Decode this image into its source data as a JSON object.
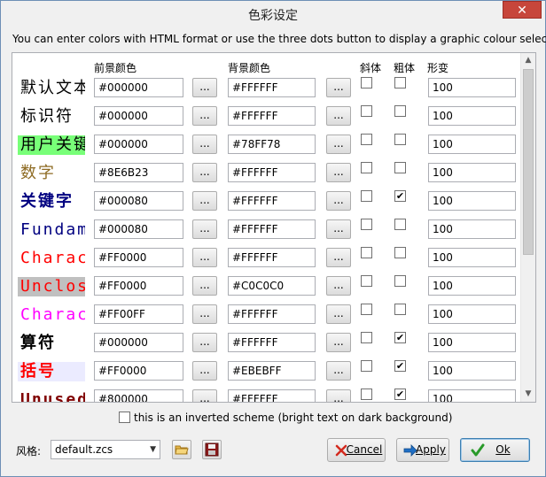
{
  "window": {
    "title": "色彩设定",
    "close_label": "✕"
  },
  "description": "You can enter colors with HTML format or use the three dots button to display a graphic colour selector.",
  "headers": {
    "fg": "前景颜色",
    "bg": "背景颜色",
    "italic": "斜体",
    "bold": "粗体",
    "scale": "形变"
  },
  "dots_label": "...",
  "rows": [
    {
      "sample": "默认文本",
      "fg": "#000000",
      "bg": "#FFFFFF",
      "italic": false,
      "bold": false,
      "scale": "100",
      "color": "#000000",
      "bgcolor": "#FFFFFF"
    },
    {
      "sample": "标识符",
      "fg": "#000000",
      "bg": "#FFFFFF",
      "italic": false,
      "bold": false,
      "scale": "100",
      "color": "#000000",
      "bgcolor": "#FFFFFF"
    },
    {
      "sample": "用户关键字",
      "fg": "#000000",
      "bg": "#78FF78",
      "italic": false,
      "bold": false,
      "scale": "100",
      "color": "#000000",
      "bgcolor": "#78FF78"
    },
    {
      "sample": "数字",
      "fg": "#8E6B23",
      "bg": "#FFFFFF",
      "italic": false,
      "bold": false,
      "scale": "100",
      "color": "#8E6B23",
      "bgcolor": "#FFFFFF"
    },
    {
      "sample": "关键字",
      "fg": "#000080",
      "bg": "#FFFFFF",
      "italic": false,
      "bold": true,
      "scale": "100",
      "color": "#000080",
      "bgcolor": "#FFFFFF"
    },
    {
      "sample": "Fundamental",
      "fg": "#000080",
      "bg": "#FFFFFF",
      "italic": false,
      "bold": false,
      "scale": "100",
      "color": "#000080",
      "bgcolor": "#FFFFFF"
    },
    {
      "sample": "Character",
      "fg": "#FF0000",
      "bg": "#FFFFFF",
      "italic": false,
      "bold": false,
      "scale": "100",
      "color": "#FF0000",
      "bgcolor": "#FFFFFF"
    },
    {
      "sample": "Unclosed",
      "fg": "#FF0000",
      "bg": "#C0C0C0",
      "italic": false,
      "bold": false,
      "scale": "100",
      "color": "#FF0000",
      "bgcolor": "#C0C0C0"
    },
    {
      "sample": "Character",
      "fg": "#FF00FF",
      "bg": "#FFFFFF",
      "italic": false,
      "bold": false,
      "scale": "100",
      "color": "#FF00FF",
      "bgcolor": "#FFFFFF"
    },
    {
      "sample": "算符",
      "fg": "#000000",
      "bg": "#FFFFFF",
      "italic": false,
      "bold": true,
      "scale": "100",
      "color": "#000000",
      "bgcolor": "#FFFFFF"
    },
    {
      "sample": "括号",
      "fg": "#FF0000",
      "bg": "#EBEBFF",
      "italic": false,
      "bold": true,
      "scale": "100",
      "color": "#FF0000",
      "bgcolor": "#EBEBFF"
    },
    {
      "sample": "Unused",
      "fg": "#800000",
      "bg": "#FFFFFF",
      "italic": false,
      "bold": true,
      "scale": "100",
      "color": "#800000",
      "bgcolor": "#FFFFFF"
    }
  ],
  "inverted_label": "this is an inverted scheme (bright text on dark background)",
  "style": {
    "label": "风格:",
    "value": "default.zcs"
  },
  "buttons": {
    "cancel": "Cancel",
    "apply": "Apply",
    "ok": "Ok"
  },
  "colors": {
    "cancel_icon": "#d42a1e",
    "apply_icon": "#1f6fc5",
    "ok_icon": "#2a9a2a"
  }
}
